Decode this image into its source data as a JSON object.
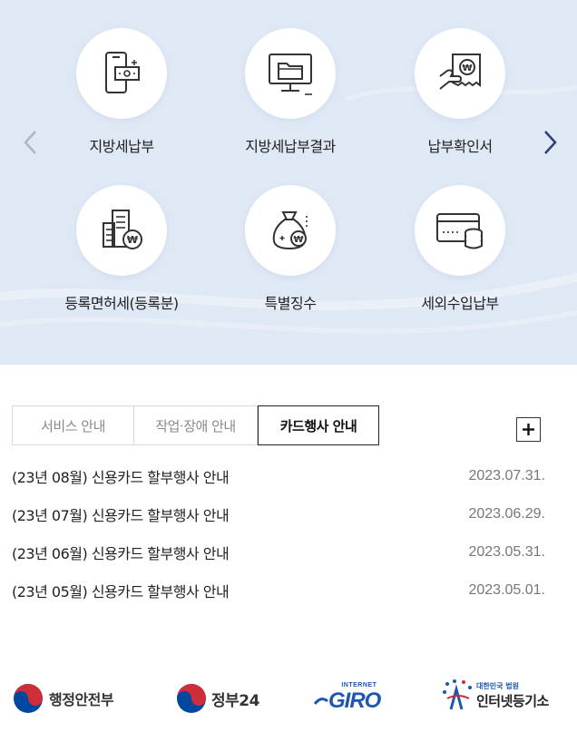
{
  "services": [
    {
      "label": "지방세납부",
      "icon": "mobile-bill-icon"
    },
    {
      "label": "지방세납부결과",
      "icon": "monitor-folder-icon"
    },
    {
      "label": "납부확인서",
      "icon": "receipt-won-icon"
    },
    {
      "label": "등록면허세(등록분)",
      "icon": "building-won-icon"
    },
    {
      "label": "특별징수",
      "icon": "money-bag-icon"
    },
    {
      "label": "세외수입납부",
      "icon": "card-coins-icon"
    }
  ],
  "tabs": [
    {
      "label": "서비스 안내",
      "active": false
    },
    {
      "label": "작업·장애 안내",
      "active": false
    },
    {
      "label": "카드행사 안내",
      "active": true
    }
  ],
  "notices": [
    {
      "title": "(23년 08월) 신용카드 할부행사 안내",
      "date": "2023.07.31."
    },
    {
      "title": "(23년 07월) 신용카드 할부행사 안내",
      "date": "2023.06.29."
    },
    {
      "title": "(23년 06월) 신용카드 할부행사 안내",
      "date": "2023.05.31."
    },
    {
      "title": "(23년 05월) 신용카드 할부행사 안내",
      "date": "2023.05.01."
    }
  ],
  "footer": {
    "mois": "행정안전부",
    "gov24": "정부24",
    "giro_top": "INTERNET",
    "giro": "GIRO",
    "court_top": "대한민국 법원",
    "court": "인터넷등기소"
  },
  "colors": {
    "hero_bg": "#dfe8f5",
    "accent_navy": "#2c3e74",
    "giro_blue": "#1f56b0",
    "taegeuk_red": "#cd2e3a",
    "taegeuk_blue": "#0047a0"
  }
}
